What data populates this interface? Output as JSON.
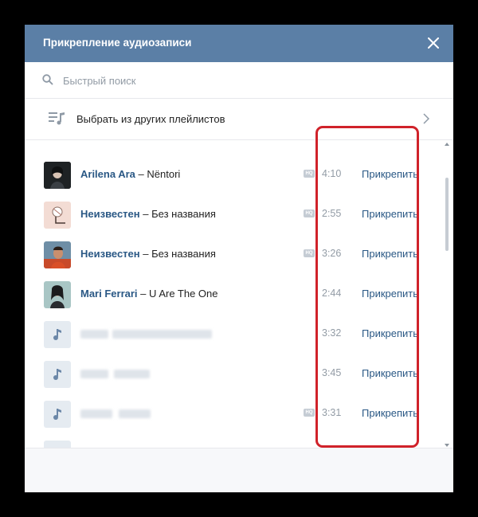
{
  "dialog": {
    "title": "Прикрепление аудиозаписи",
    "close_icon": "close-icon"
  },
  "search": {
    "placeholder": "Быстрый поиск",
    "value": ""
  },
  "playlists": {
    "label": "Выбрать из других плейлистов"
  },
  "tracks": [
    {
      "artist": "Arilena Ara",
      "dash": "–",
      "title": "Nëntori",
      "duration": "4:10",
      "hq": true,
      "attach_label": "Прикрепить"
    },
    {
      "artist": "Неизвестен",
      "dash": "–",
      "title": "Без названия",
      "duration": "2:55",
      "hq": true,
      "attach_label": "Прикрепить"
    },
    {
      "artist": "Неизвестен",
      "dash": "–",
      "title": "Без названия",
      "duration": "3:26",
      "hq": true,
      "attach_label": "Прикрепить"
    },
    {
      "artist": "Mari Ferrari",
      "dash": "–",
      "title": "U Are The One",
      "duration": "2:44",
      "hq": false,
      "attach_label": "Прикрепить"
    },
    {
      "artist": "",
      "dash": "",
      "title": "",
      "duration": "3:32",
      "hq": false,
      "attach_label": "Прикрепить"
    },
    {
      "artist": "",
      "dash": "",
      "title": "",
      "duration": "3:45",
      "hq": false,
      "attach_label": "Прикрепить"
    },
    {
      "artist": "",
      "dash": "",
      "title": "",
      "duration": "3:31",
      "hq": true,
      "attach_label": "Прикрепить"
    }
  ],
  "hq_badge": "HQ",
  "colors": {
    "header": "#5b7fa6",
    "link": "#2a5885",
    "highlight": "#d0222a"
  }
}
